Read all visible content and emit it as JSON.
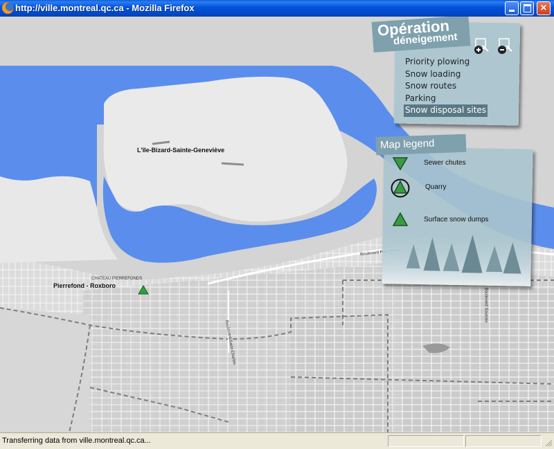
{
  "window": {
    "title": "http://ville.montreal.qc.ca - Mozilla Firefox",
    "controls": {
      "minimize": "minimize",
      "maximize": "maximize",
      "close": "×"
    }
  },
  "operation_panel": {
    "title_line1": "Opération",
    "title_line2": "déneigement",
    "zoom_in_icon": "zoom-in",
    "zoom_out_icon": "zoom-out",
    "menu": [
      {
        "label": "Priority plowing"
      },
      {
        "label": "Snow loading"
      },
      {
        "label": "Snow routes"
      },
      {
        "label": "Parking"
      },
      {
        "label": "Snow disposal sites",
        "active": true
      }
    ]
  },
  "legend": {
    "title": "Map legend",
    "items": [
      {
        "label": "Sewer chutes",
        "symbol": "triangle-down-green"
      },
      {
        "label": "Quarry",
        "symbol": "triangle-circle-green"
      },
      {
        "label": "Surface snow dumps",
        "symbol": "triangle-up-green"
      }
    ]
  },
  "map": {
    "labels": {
      "island": "L'île-Bizard-Sainte-Geneviève",
      "borough": "Pierrefond - Roxboro",
      "chateau": "CHATEAU PIERREFONDS",
      "boulevard": "Boulevard Pierrefonds",
      "street_vertical": "Boulevard Saint-Charles",
      "street_right": "Boulevard Sources"
    },
    "colors": {
      "water": "#5b8eec",
      "land": "#e6e6e6",
      "land_dark": "#cfcfcf",
      "marker": "#2fa03c"
    }
  },
  "statusbar": {
    "text": "Transferring data from ville.montreal.qc.ca..."
  }
}
